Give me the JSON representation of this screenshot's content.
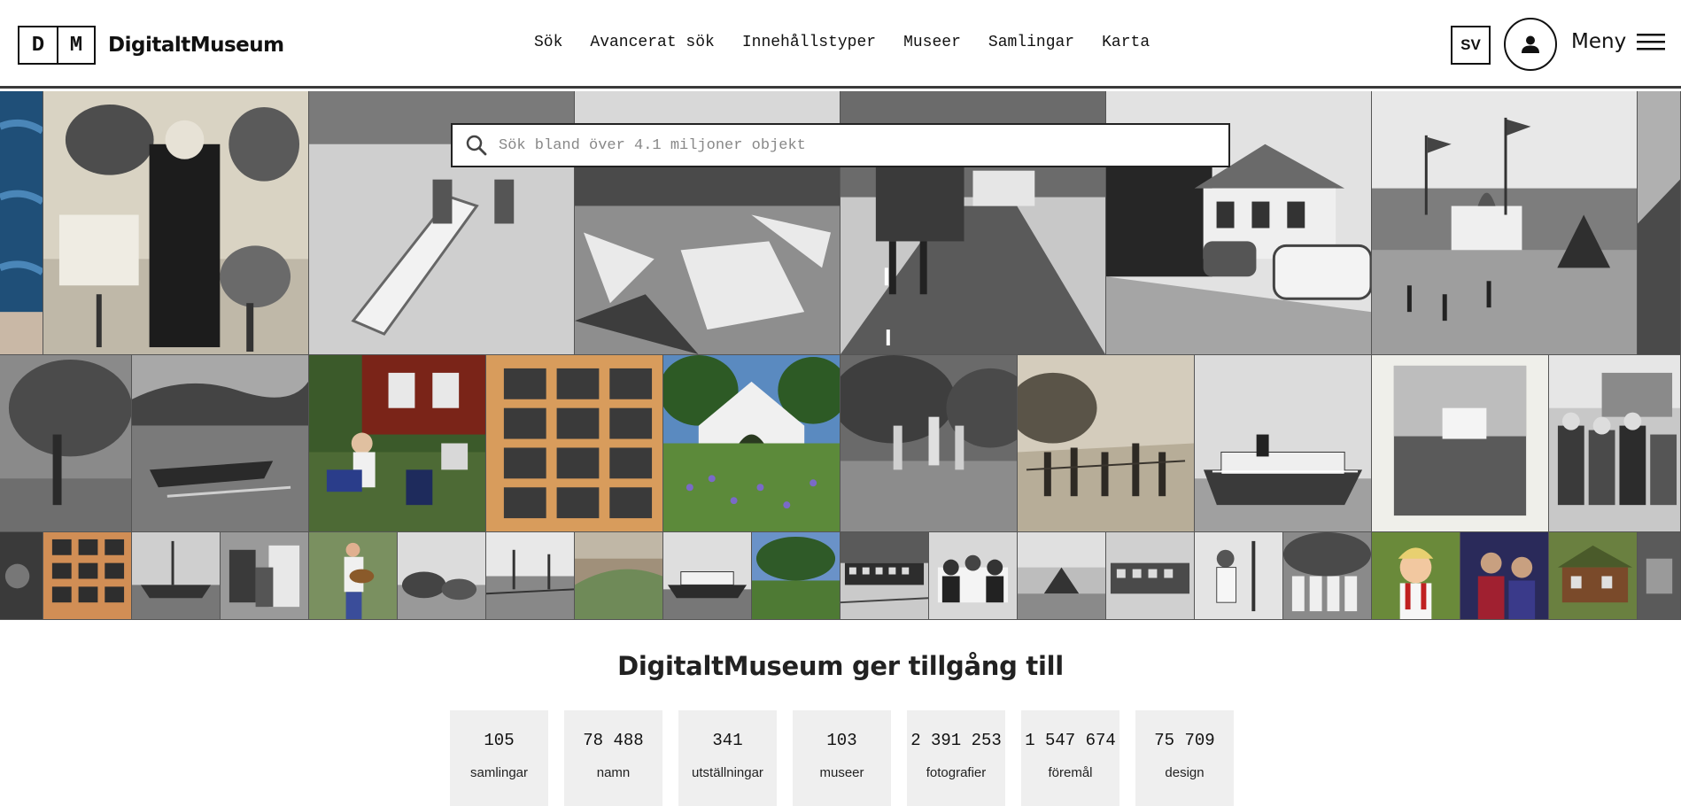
{
  "brand": {
    "letter1": "D",
    "letter2": "M",
    "name": "DigitaltMuseum"
  },
  "nav": [
    {
      "label": "Sök"
    },
    {
      "label": "Avancerat sök"
    },
    {
      "label": "Innehållstyper"
    },
    {
      "label": "Museer"
    },
    {
      "label": "Samlingar"
    },
    {
      "label": "Karta"
    }
  ],
  "header": {
    "language": "SV",
    "menu_label": "Meny"
  },
  "search": {
    "placeholder": "Sök bland över 4.1 miljoner objekt",
    "value": ""
  },
  "icons": {
    "search": "search-icon",
    "user": "user-icon",
    "menu": "hamburger-icon"
  },
  "stats": {
    "title": "DigitaltMuseum ger tillgång till",
    "items": [
      {
        "value": "105",
        "label": "samlingar"
      },
      {
        "value": "78 488",
        "label": "namn"
      },
      {
        "value": "341",
        "label": "utställningar"
      },
      {
        "value": "103",
        "label": "museer"
      },
      {
        "value": "2 391 253",
        "label": "fotografier"
      },
      {
        "value": "1 547 674",
        "label": "föremål"
      },
      {
        "value": "75 709",
        "label": "design"
      }
    ]
  }
}
